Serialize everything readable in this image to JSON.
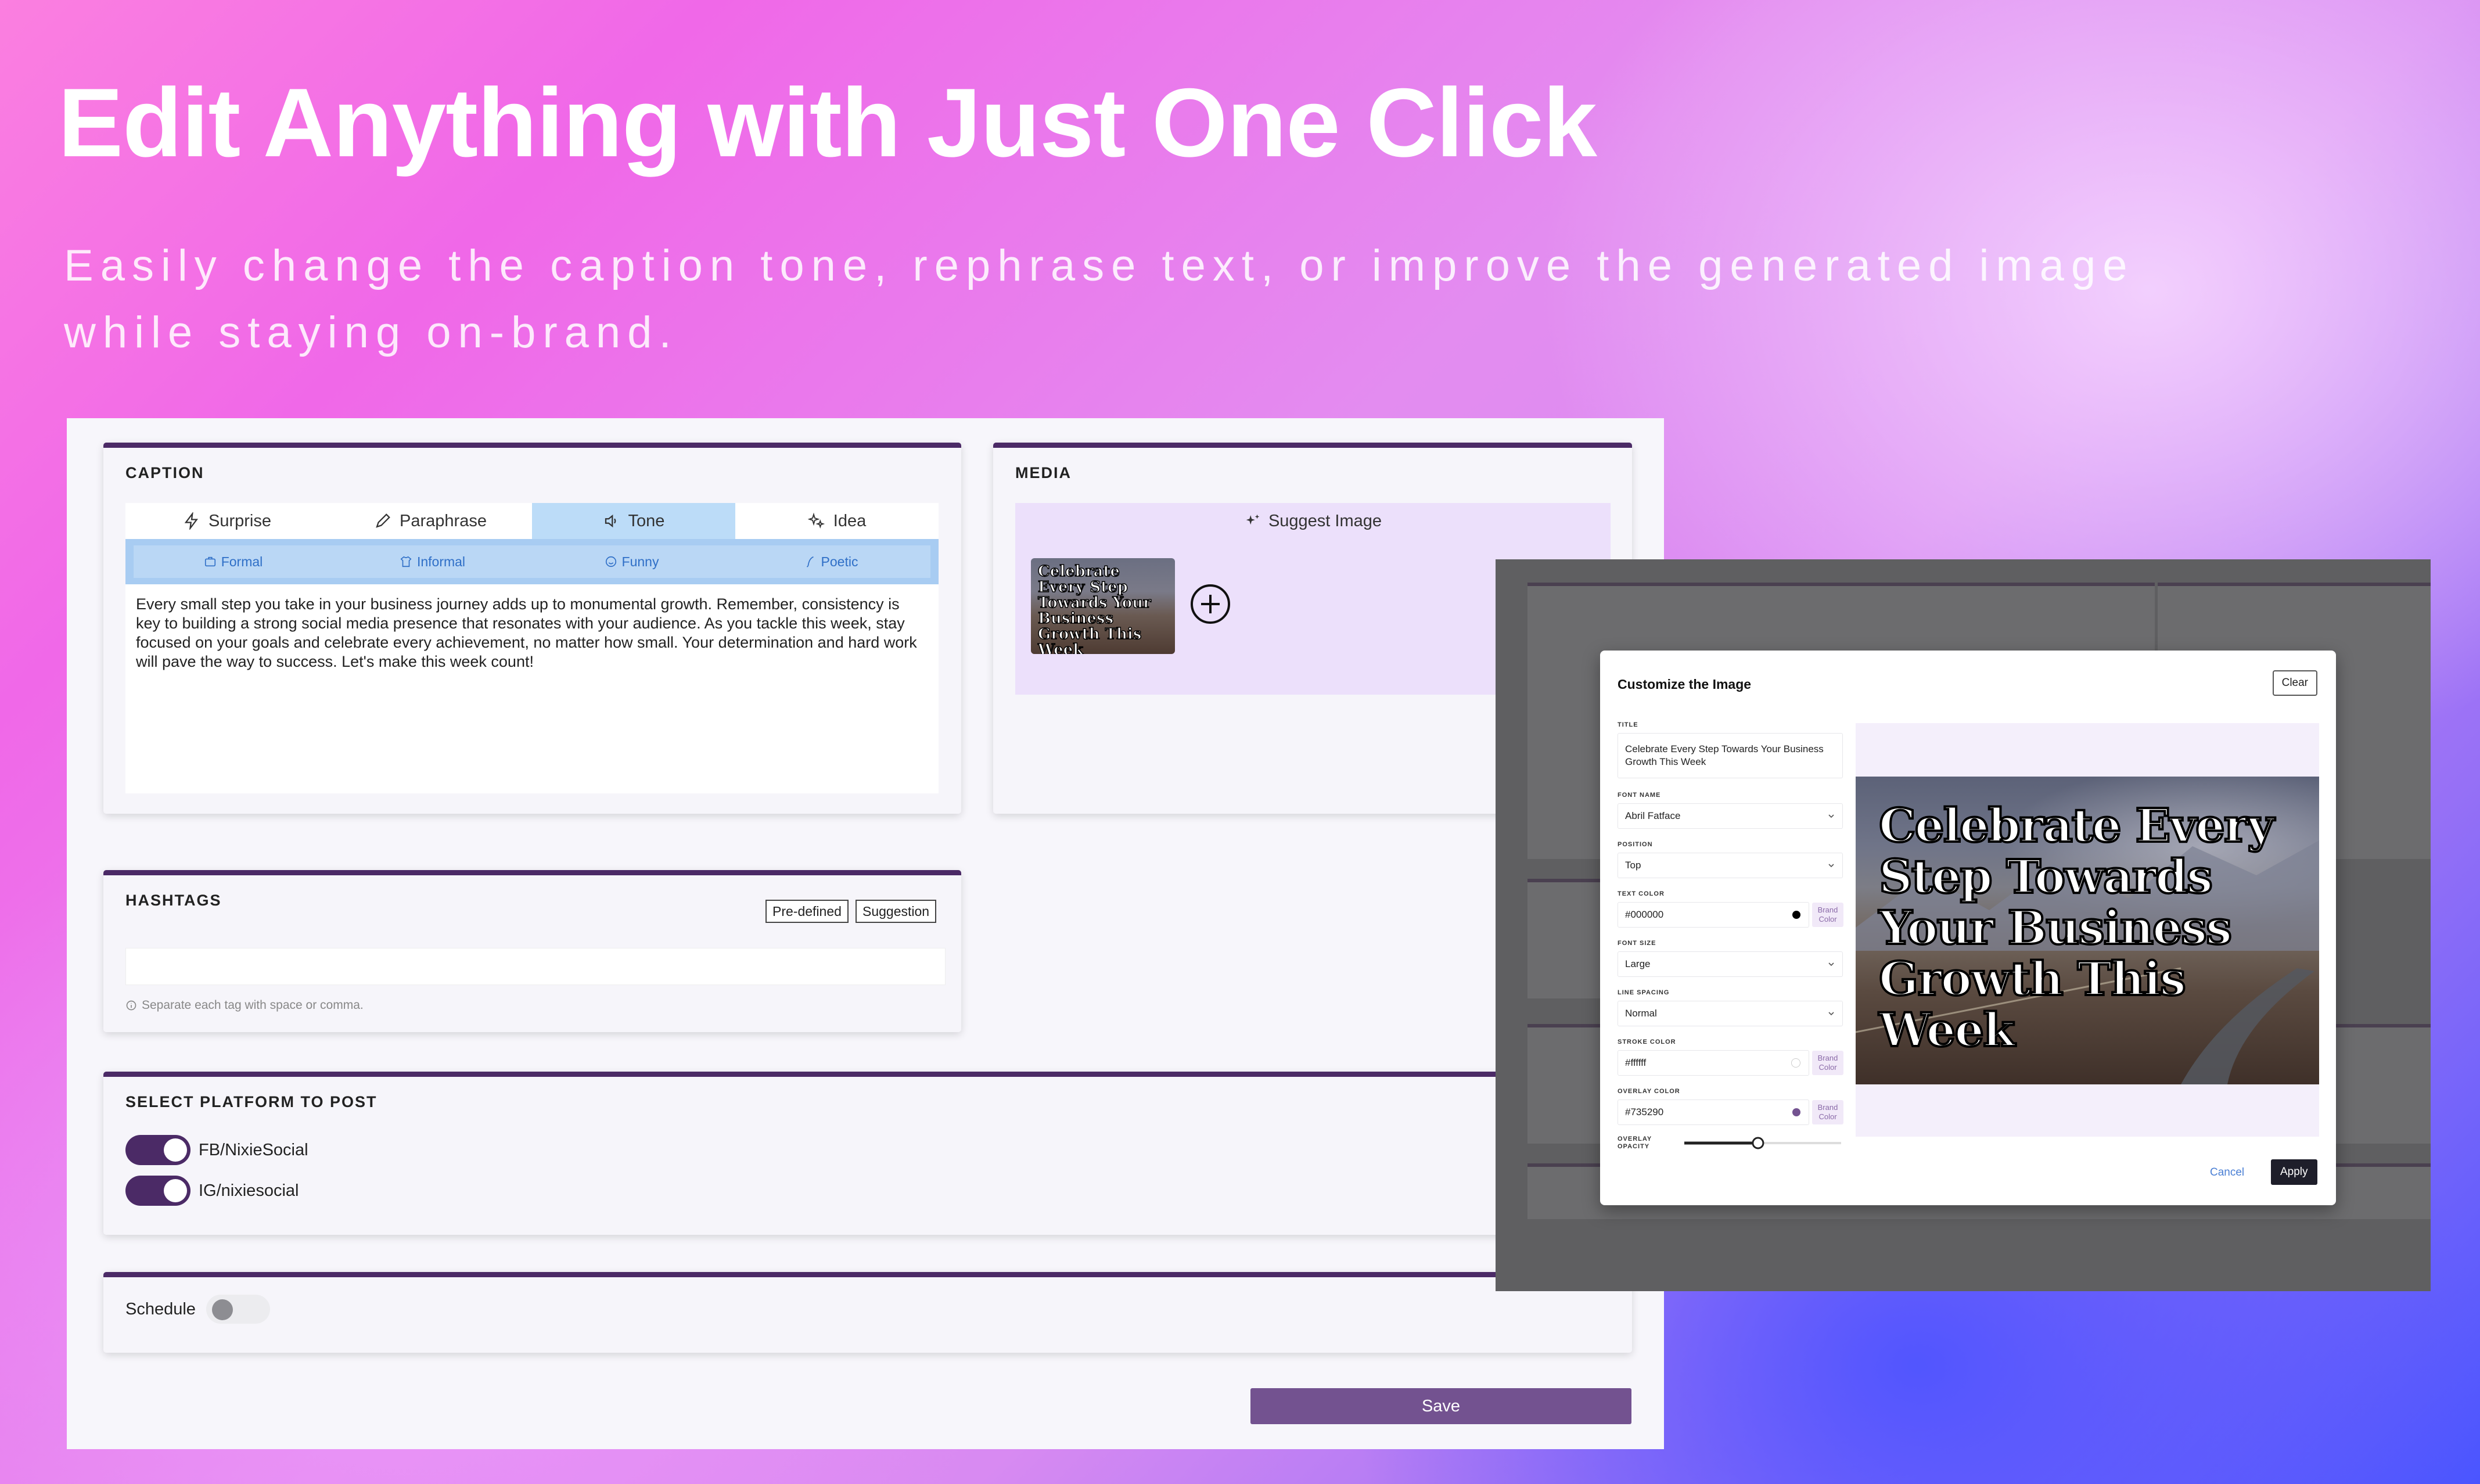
{
  "hero": {
    "title": "Edit Anything with Just One Click",
    "subtitle": "Easily change the caption tone, rephrase text, or improve the generated image while staying on-brand."
  },
  "caption": {
    "title": "CAPTION",
    "tabs": [
      {
        "label": "Surprise",
        "icon": "lightning-icon"
      },
      {
        "label": "Paraphrase",
        "icon": "pencil-icon"
      },
      {
        "label": "Tone",
        "icon": "speaker-icon",
        "active": true
      },
      {
        "label": "Idea",
        "icon": "sparkle-icon"
      }
    ],
    "tones": [
      {
        "label": "Formal",
        "icon": "briefcase-icon"
      },
      {
        "label": "Informal",
        "icon": "shirt-icon"
      },
      {
        "label": "Funny",
        "icon": "smile-icon"
      },
      {
        "label": "Poetic",
        "icon": "quill-icon"
      }
    ],
    "text": "Every small step you take in your business journey adds up to monumental growth. Remember, consistency is key to building a strong social media presence that resonates with your audience. As you tackle this week, stay focused on your goals and celebrate every achievement, no matter how small. Your determination and hard work will pave the way to success. Let's make this week count!"
  },
  "media": {
    "title": "MEDIA",
    "suggest_label": "Suggest Image",
    "thumb_text": "Celebrate Every Step Towards Your Business Growth This Week"
  },
  "hashtags": {
    "title": "HASHTAGS",
    "predefined_label": "Pre-defined",
    "suggestion_label": "Suggestion",
    "hint": "Separate each tag with space or comma."
  },
  "platforms": {
    "title": "SELECT PLATFORM TO POST",
    "items": [
      {
        "label": "FB/NixieSocial",
        "on": true
      },
      {
        "label": "IG/nixiesocial",
        "on": true
      }
    ]
  },
  "schedule": {
    "label": "Schedule",
    "on": false
  },
  "save_label": "Save",
  "modal": {
    "title": "Customize the Image",
    "clear_label": "Clear",
    "fields": {
      "title_label": "TITLE",
      "title_value": "Celebrate Every Step Towards Your Business Growth This Week",
      "font_name_label": "FONT NAME",
      "font_name_value": "Abril Fatface",
      "position_label": "POSITION",
      "position_value": "Top",
      "text_color_label": "TEXT COLOR",
      "text_color_value": "#000000",
      "font_size_label": "FONT SIZE",
      "font_size_value": "Large",
      "line_spacing_label": "LINE SPACING",
      "line_spacing_value": "Normal",
      "stroke_color_label": "STROKE COLOR",
      "stroke_color_value": "#ffffff",
      "overlay_color_label": "OVERLAY COLOR",
      "overlay_color_value": "#735290",
      "overlay_opacity_label": "OVERLAY OPACITY",
      "overlay_opacity_fraction": 0.47
    },
    "brand_color_label": "Brand Color",
    "preview_text": "Celebrate Every Step Towards Your Business Growth This Week",
    "cancel_label": "Cancel",
    "apply_label": "Apply"
  },
  "colors": {
    "accent": "#4b2a66",
    "save_button": "#735290",
    "tone_active": "#bcdcf8",
    "tone_text": "#2f6fc7"
  }
}
